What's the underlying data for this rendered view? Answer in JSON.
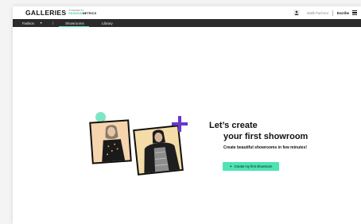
{
  "header": {
    "logo_text": "GALLERIES",
    "logo_powered": "POWERED BY",
    "logo_brand_accent": "FASHION",
    "logo_brand": "METRICS",
    "user_name": "Malik Pacheco",
    "company": "Escribe"
  },
  "nav": {
    "dropdown_label": "Fashion",
    "tabs": [
      {
        "label": "Showrooms",
        "active": true
      },
      {
        "label": "Library",
        "active": false
      }
    ]
  },
  "empty_state": {
    "title_line1": "Let’s create",
    "title_line2": "your first showroom",
    "subtitle": "Create beautiful showrooms in few minutes!",
    "cta_icon": "+",
    "cta_label": "Create my first showroom"
  },
  "colors": {
    "accent": "#4de3b3",
    "plus_purple": "#6a36d0",
    "nav_bg": "#2b2b2b"
  },
  "icons": [
    "user-icon",
    "chevron-down-icon",
    "apps-grid-icon",
    "plus-icon"
  ]
}
